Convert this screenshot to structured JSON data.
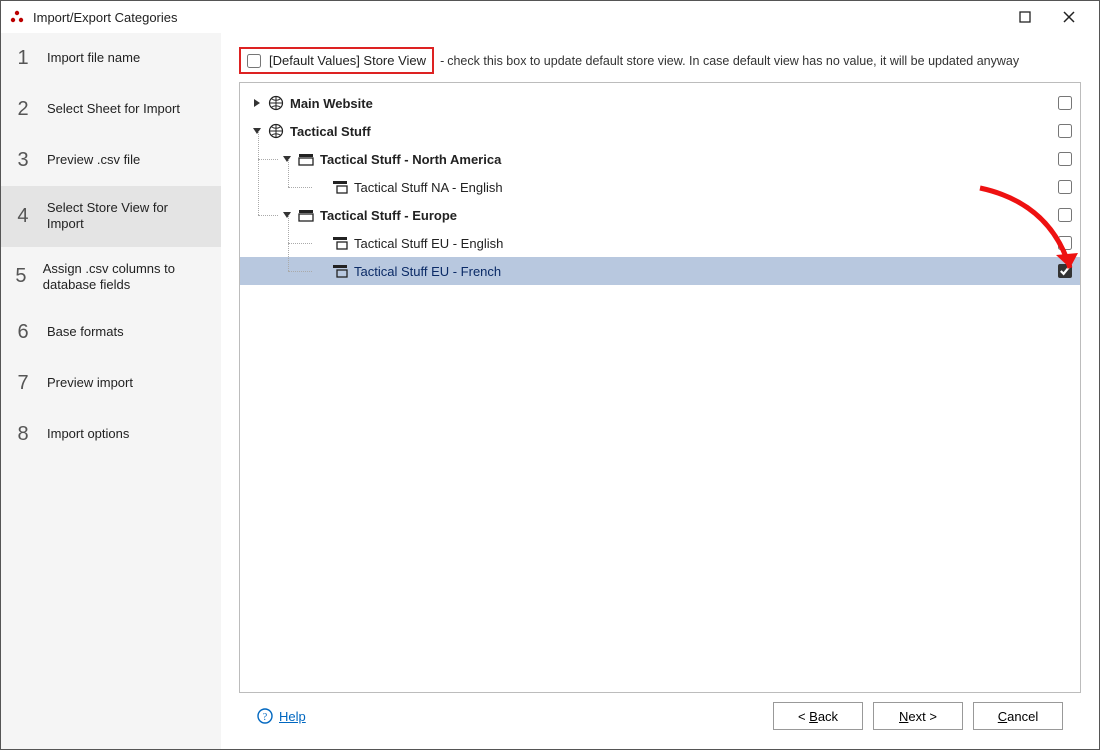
{
  "window": {
    "title": "Import/Export Categories"
  },
  "sidebar": {
    "steps": [
      {
        "num": "1",
        "label": "Import file name"
      },
      {
        "num": "2",
        "label": "Select Sheet for Import"
      },
      {
        "num": "3",
        "label": "Preview .csv file"
      },
      {
        "num": "4",
        "label": "Select Store View for Import"
      },
      {
        "num": "5",
        "label": "Assign .csv columns to database fields"
      },
      {
        "num": "6",
        "label": "Base formats"
      },
      {
        "num": "7",
        "label": "Preview import"
      },
      {
        "num": "8",
        "label": "Import options"
      }
    ],
    "active_index": 3
  },
  "default_values": {
    "checked": false,
    "label": "[Default Values] Store View",
    "hint": "check this box to update default store view. In case default view has no value, it will be updated anyway"
  },
  "tree": {
    "nodes": [
      {
        "id": "main-website",
        "level": 0,
        "type": "website",
        "label": "Main Website",
        "expanded": false,
        "bold": true,
        "checked": false,
        "selected": false
      },
      {
        "id": "tactical-stuff",
        "level": 0,
        "type": "website",
        "label": "Tactical Stuff",
        "expanded": true,
        "bold": true,
        "checked": false,
        "selected": false
      },
      {
        "id": "ts-na",
        "level": 1,
        "type": "group",
        "label": "Tactical Stuff - North America",
        "expanded": true,
        "bold": true,
        "checked": false,
        "selected": false
      },
      {
        "id": "ts-na-en",
        "level": 2,
        "type": "view",
        "label": "Tactical Stuff NA - English",
        "expanded": null,
        "bold": false,
        "checked": false,
        "selected": false
      },
      {
        "id": "ts-eu",
        "level": 1,
        "type": "group",
        "label": "Tactical Stuff - Europe",
        "expanded": true,
        "bold": true,
        "checked": false,
        "selected": false
      },
      {
        "id": "ts-eu-en",
        "level": 2,
        "type": "view",
        "label": "Tactical Stuff EU - English",
        "expanded": null,
        "bold": false,
        "checked": false,
        "selected": false
      },
      {
        "id": "ts-eu-fr",
        "level": 2,
        "type": "view",
        "label": "Tactical Stuff EU - French",
        "expanded": null,
        "bold": false,
        "checked": true,
        "selected": true
      }
    ]
  },
  "footer": {
    "help": "Help",
    "back": "< Back",
    "next": "Next >",
    "cancel": "Cancel"
  }
}
